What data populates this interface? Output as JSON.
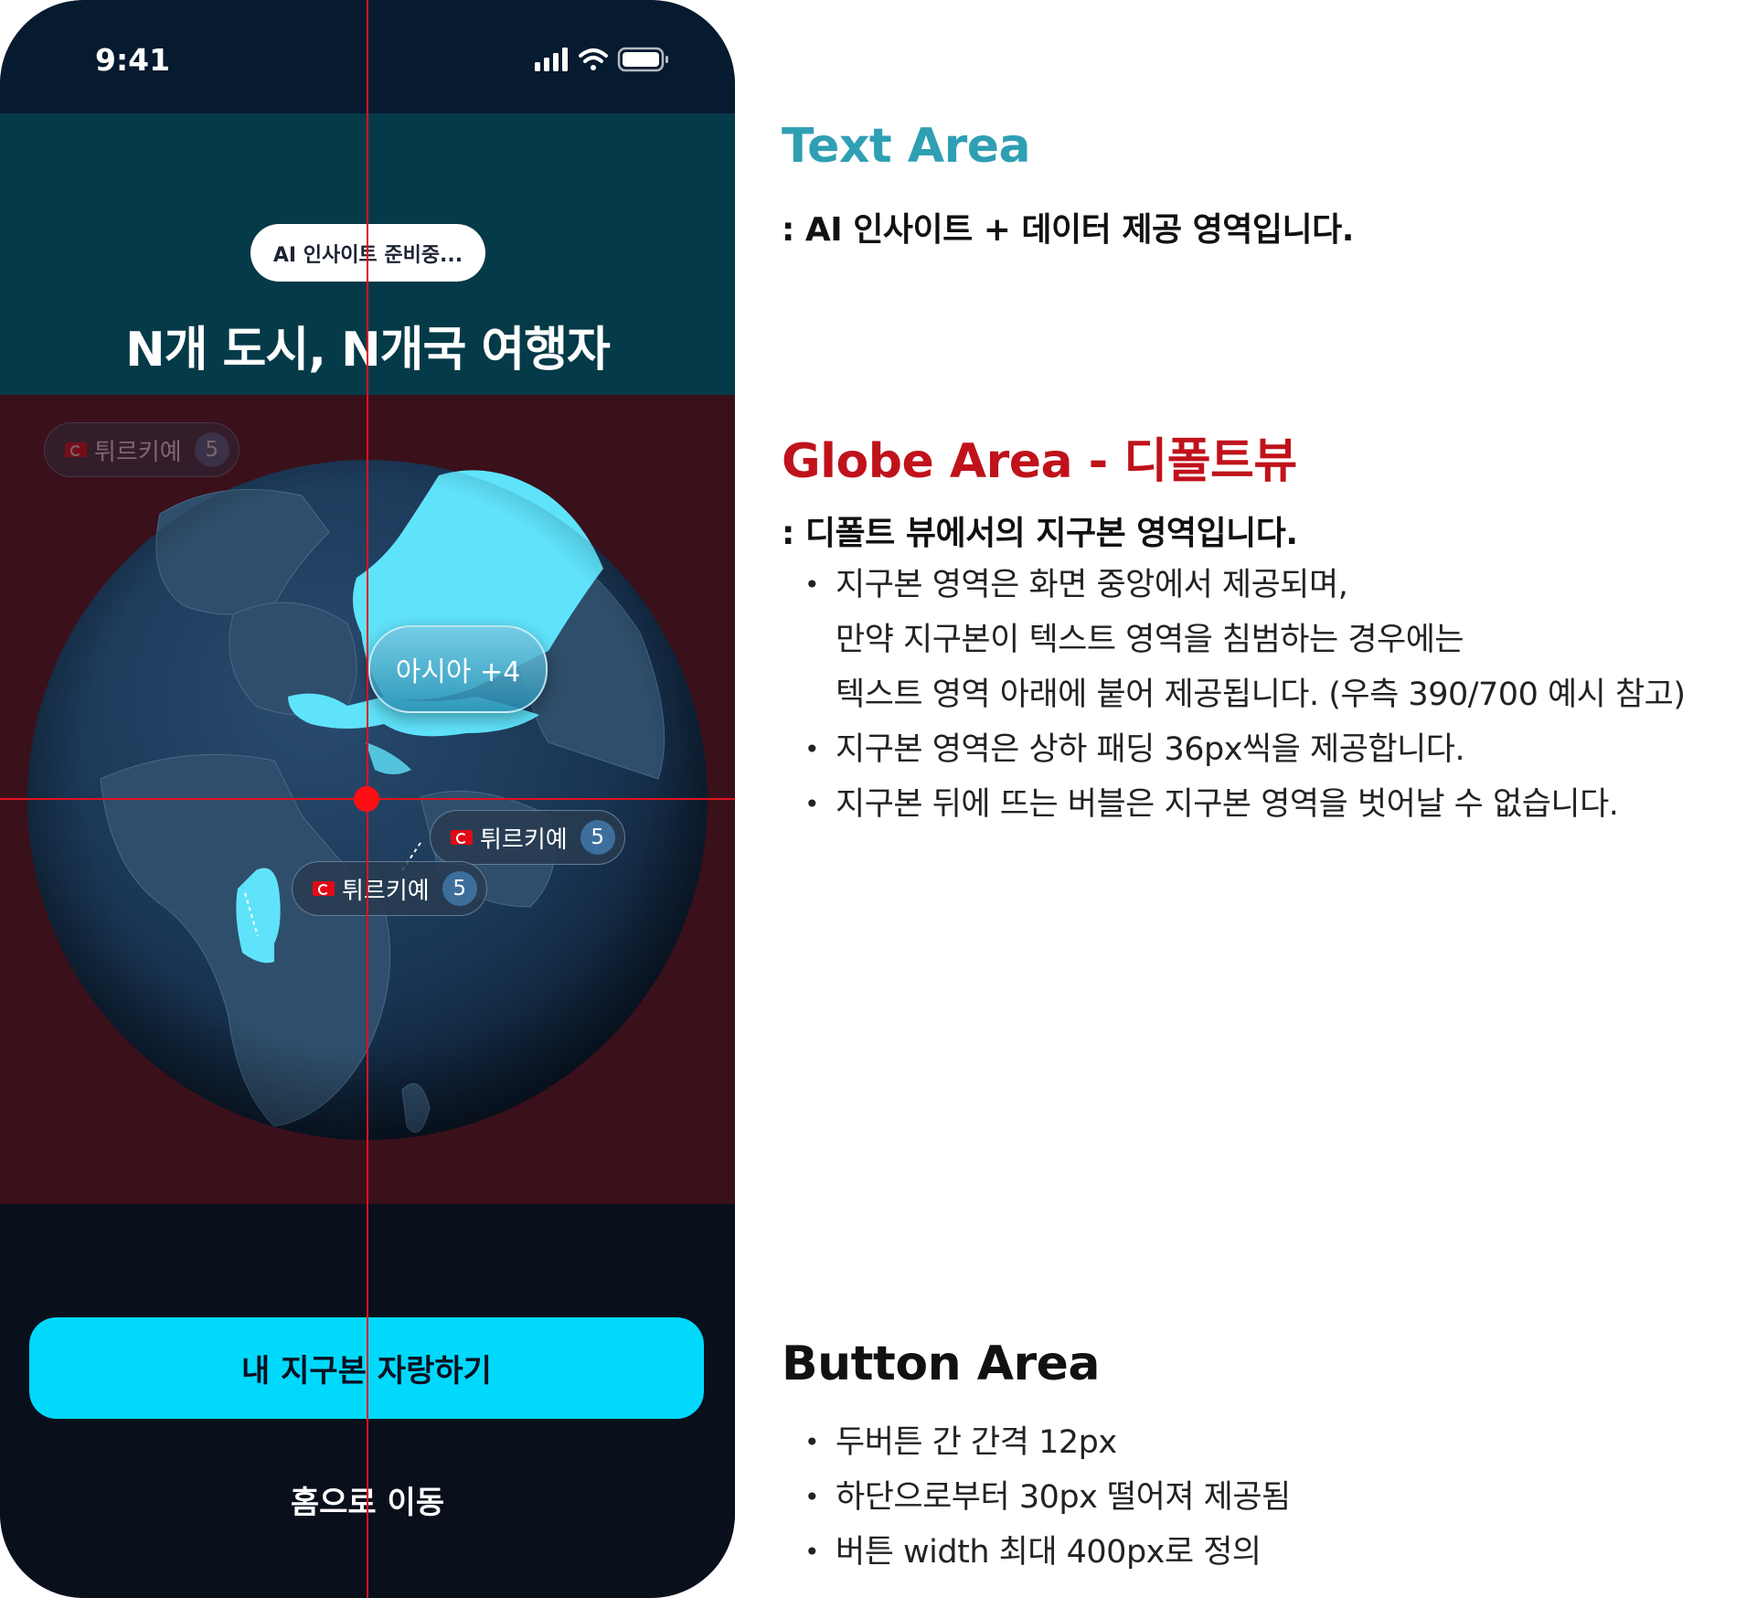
{
  "phone": {
    "status_time": "9:41",
    "ai_pill": "AI 인사이트 준비중...",
    "headline": "N개 도시, N개국 여행자",
    "asia_bubble": "아시아 +4",
    "bubbles": [
      {
        "country": "튀르키예",
        "count": "5"
      },
      {
        "country": "튀르키예",
        "count": "5"
      },
      {
        "country": "튀르키예",
        "count": "5"
      }
    ],
    "primary_button": "내 지구본 자랑하기",
    "secondary_button": "홈으로 이동"
  },
  "annotations": {
    "text_area": {
      "title": "Text Area",
      "subtitle": ": AI 인사이트 + 데이터 제공 영역입니다."
    },
    "globe_area": {
      "title": "Globe Area - 디폴트뷰",
      "subtitle": ": 디폴트 뷰에서의 지구본 영역입니다.",
      "bullets": [
        [
          "지구본 영역은 화면 중앙에서 제공되며,",
          "만약 지구본이 텍스트 영역을 침범하는 경우에는",
          "텍스트 영역 아래에 붙어 제공됩니다. (우측 390/700 예시 참고)"
        ],
        [
          "지구본 영역은 상하 패딩 36px씩을 제공합니다."
        ],
        [
          "지구본 뒤에 뜨는 버블은 지구본 영역을 벗어날 수 없습니다."
        ]
      ]
    },
    "button_area": {
      "title": "Button Area",
      "bullets": [
        "두버튼 간 간격 12px",
        "하단으로부터 30px 떨어져 제공됨",
        "버튼 width 최대 400px로 정의"
      ]
    }
  },
  "colors": {
    "text_area_title": "#2f9fb3",
    "globe_area_title": "#c0121b",
    "button_area_title": "#111111",
    "primary_button": "#00d9fb",
    "guide_line": "#e1121e",
    "highlight_land": "#5fe3fb"
  }
}
